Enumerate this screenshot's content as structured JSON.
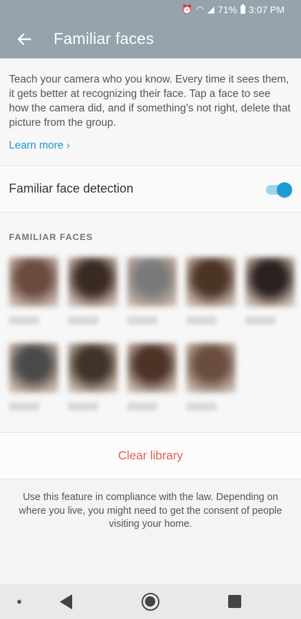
{
  "status_bar": {
    "battery_percent": "71%",
    "time": "3:07 PM",
    "icons": [
      "alarm-icon",
      "wifi-icon",
      "signal-icon",
      "battery-icon"
    ]
  },
  "app_bar": {
    "title": "Familiar faces",
    "back_icon": "arrow-left-icon"
  },
  "intro": {
    "text": "Teach your camera who you know. Every time it sees them, it gets better at recognizing their face. Tap a face to see how the camera did, and if something’s not right, delete that picture from the group.",
    "learn_more": "Learn more ›"
  },
  "detection": {
    "label": "Familiar face detection",
    "enabled": true
  },
  "faces": {
    "header": "FAMILIAR  FACES",
    "items": [
      {
        "tone": "#6b4a3f"
      },
      {
        "tone": "#3a2a24"
      },
      {
        "tone": "#7a7a7a"
      },
      {
        "tone": "#4b3325"
      },
      {
        "tone": "#2a2220"
      },
      {
        "tone": "#4a4a4a"
      },
      {
        "tone": "#3e3428"
      },
      {
        "tone": "#4d3226"
      },
      {
        "tone": "#6a4d3f"
      }
    ]
  },
  "clear_library": "Clear library",
  "compliance_text": "Use this feature in compliance with the law. Depending on where you live, you might need to get the consent of people visiting your home.",
  "colors": {
    "app_bar": "#95a3ad",
    "accent": "#1a9bd7",
    "destructive": "#e0604f"
  }
}
